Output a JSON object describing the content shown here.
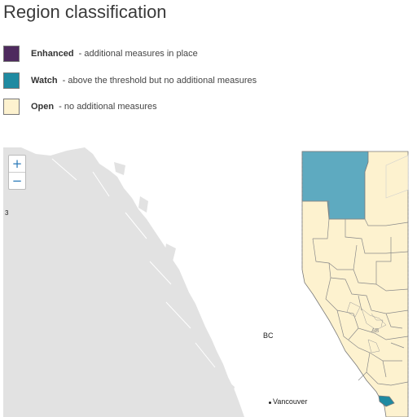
{
  "title": "Region classification",
  "legend": [
    {
      "label": "Enhanced",
      "separator": " - ",
      "description": "additional measures in place",
      "color": "#4e2a5e"
    },
    {
      "label": "Watch",
      "separator": " - ",
      "description": "above the threshold but no additional measures",
      "color": "#1f8aa1"
    },
    {
      "label": "Open",
      "separator": " - ",
      "description": "no additional measures",
      "color": "#fdf2cf"
    }
  ],
  "map": {
    "zoom_in": "+",
    "zoom_out": "−",
    "edge_marker": "3",
    "labels": {
      "province": "BC",
      "ab_small": "AB",
      "city": "Vancouver"
    },
    "colors": {
      "land": "#e2e2e2",
      "water": "#ffffff",
      "open": "#fdf2cf",
      "watch": "#5eaac0",
      "watch_dark": "#1f8aa1",
      "border": "#7a7a7a"
    }
  }
}
